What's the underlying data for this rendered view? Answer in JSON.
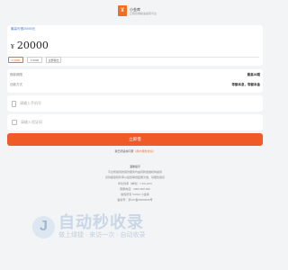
{
  "brand": {
    "logo_glyph": "¥",
    "name": "小金库",
    "sub": "正规合规极速提现平台"
  },
  "amount_card": {
    "limit_label": "最高可借20000元",
    "currency": "¥",
    "amount": "20000"
  },
  "quick_amounts": [
    {
      "label": "¥ 2000",
      "active": true
    },
    {
      "label": "¥ 5000",
      "active": false
    },
    {
      "label": "全部借出",
      "active": false
    }
  ],
  "info": [
    {
      "key": "借款期限",
      "value": "最高36期"
    },
    {
      "key": "还款方式",
      "value": "等额本息，等额本金"
    }
  ],
  "phone_field": {
    "placeholder": "请输入手机号"
  },
  "code_field": {
    "placeholder": "请输入验证码"
  },
  "submit_label": "立即借",
  "agreement": {
    "prefix": "我已阅读并同意",
    "link": "《用户服务协议》"
  },
  "footer": {
    "title": "温馨提示",
    "lines": [
      "平台所提供的借款服务均由持牌金融机构提供",
      "贷款额度和利率以最终审批结果为准，请理性借贷",
      "年化利率（单利）7.2%-24%",
      "客服电话：4000-000-000",
      "版权所有 ©2024 小金库",
      "备案号：京ICP备00000000号"
    ]
  },
  "watermark": {
    "logo_glyph": "J",
    "title": "自动秒收录",
    "sub": "做上绿捷 · 来访一次 · 自动收录"
  },
  "colors": {
    "accent": "#f26f21",
    "button": "#ef5a28",
    "link_blue": "#4a7bd0"
  }
}
